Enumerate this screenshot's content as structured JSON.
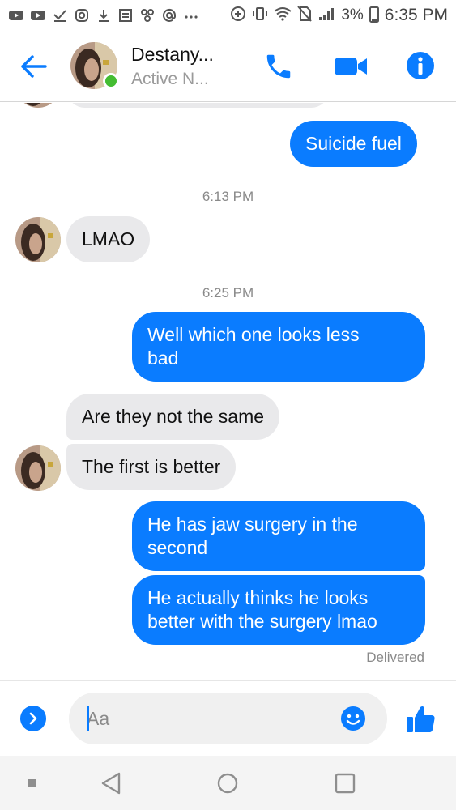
{
  "status_bar": {
    "left_icons": [
      "youtube-icon",
      "youtube-icon",
      "check-icon",
      "instagram-icon",
      "download-icon",
      "news-icon",
      "share-icon",
      "at-icon",
      "more-dots-icon"
    ],
    "battery": "3%",
    "time": "6:35 PM"
  },
  "header": {
    "contact_name": "Destany...",
    "status": "Active N..."
  },
  "messages": {
    "m0": "Suicide fuel",
    "ts1": "6:13 PM",
    "m1": "LMAO",
    "ts2": "6:25 PM",
    "m2_line1": "Well which one looks less",
    "m2_line2": "bad",
    "m3": "Are they not the same",
    "m4": "The first is better",
    "m5_line1": "He has jaw surgery in the",
    "m5_line2": "second",
    "m6_line1": "He actually thinks he looks",
    "m6_line2": "better with the surgery lmao",
    "delivered": "Delivered"
  },
  "composer": {
    "placeholder": "Aa"
  },
  "colors": {
    "accent": "#0a7cff",
    "incoming_bubble": "#e9e9eb",
    "online": "#44bd32"
  }
}
